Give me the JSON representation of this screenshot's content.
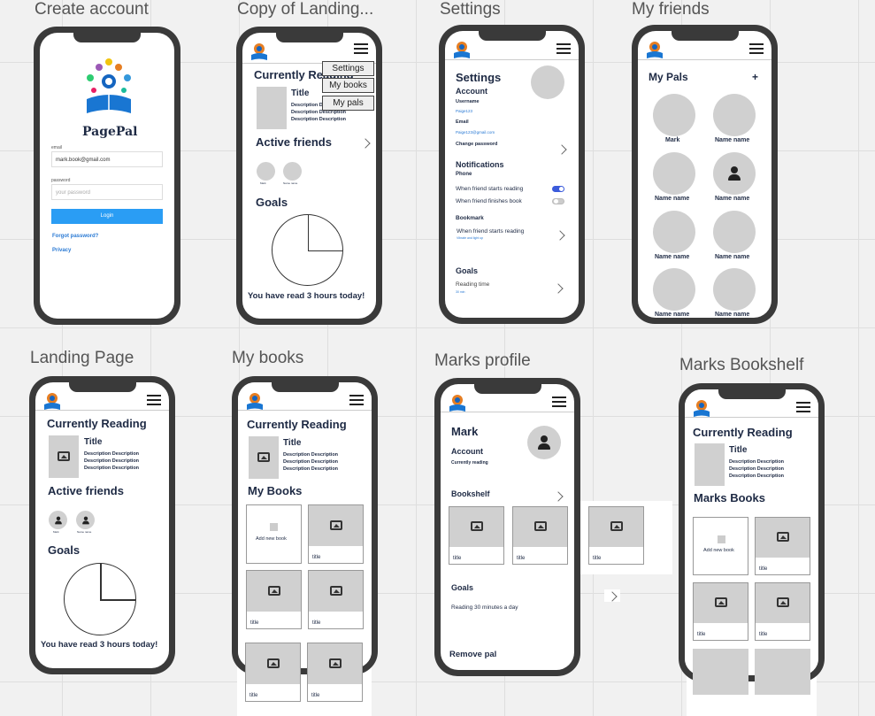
{
  "frames": {
    "create_account": {
      "title": "Create account",
      "brand": "PagePal",
      "email_label": "email",
      "email_value": "mark.book@gmail.com",
      "password_label": "password",
      "password_placeholder": "your password",
      "login": "Login",
      "forgot": "Forgot password?",
      "privacy": "Privacy"
    },
    "copy_landing": {
      "title": "Copy of Landing...",
      "currently_reading": "Currently Reading",
      "book_title": "Title",
      "desc": "Description Description",
      "active_friends": "Active friends",
      "friend1": "Mark",
      "friend2": "Name name",
      "goals": "Goals",
      "read_today": "You have read 3 hours today!",
      "menu": [
        "Settings",
        "My books",
        "My pals"
      ]
    },
    "settings": {
      "title": "Settings",
      "heading": "Settings",
      "account": "Account",
      "username_label": "Username",
      "username_value": "Paige123",
      "email_label": "Email",
      "email_value": "Paige123@gmail.com",
      "change_password": "Change password",
      "notifications": "Notifications",
      "phone": "Phone",
      "notif1": "When friend starts reading",
      "notif2": "When friend finishes book",
      "notif1_on": true,
      "notif2_on": false,
      "bookmark": "Bookmark",
      "bookmark_item": "When friend starts reading",
      "bookmark_sub": "Vibrate and light up",
      "goals": "Goals",
      "reading_time": "Reading time",
      "reading_time_value": "30 min"
    },
    "my_friends": {
      "title": "My friends",
      "heading": "My Pals",
      "add": "+",
      "names": [
        "Mark",
        "Name name",
        "Name name",
        "Name name",
        "Name name",
        "Name name",
        "Name name",
        "Name name"
      ]
    },
    "landing": {
      "title": "Landing Page",
      "currently_reading": "Currently Reading",
      "book_title": "Title",
      "desc": "Description Description",
      "active_friends": "Active friends",
      "friend1": "Mark",
      "friend2": "Name name",
      "goals": "Goals",
      "read_today": "You have read 3 hours today!"
    },
    "my_books": {
      "title": "My books",
      "currently_reading": "Currently Reading",
      "book_title": "Title",
      "desc": "Description Description",
      "my_books": "My Books",
      "add_new": "Add new book",
      "item": "title"
    },
    "marks_profile": {
      "title": "Marks profile",
      "name": "Mark",
      "account": "Account",
      "status": "Currently reading",
      "bookshelf": "Bookshelf",
      "item": "title",
      "goals": "Goals",
      "goal_text": "Reading 30 minutes a day",
      "remove": "Remove pal"
    },
    "marks_bookshelf": {
      "title": "Marks Bookshelf",
      "currently_reading": "Currently Reading",
      "book_title": "Title",
      "desc": "Description Description",
      "marks_books": "Marks Books",
      "add_new": "Add new book",
      "item": "title"
    }
  },
  "colors": {
    "accent": "#2a9df4",
    "toggle_on": "#3b5bdb",
    "text": "#1e2a44"
  },
  "icons": [
    "hamburger-menu-icon",
    "image-placeholder-icon",
    "avatar-icon",
    "chevron-right-icon",
    "pagepal-logo"
  ]
}
